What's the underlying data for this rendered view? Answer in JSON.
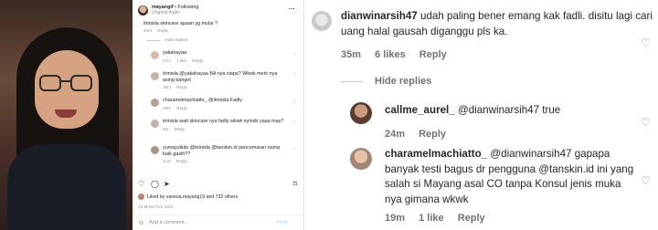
{
  "post": {
    "username": "mayangif",
    "following": "Following",
    "audio": "Original Audio",
    "more_icon": "more-horizontal-icon",
    "comments": [
      {
        "text": "itrinisla skincare apaan yg mulai ?",
        "meta": [
          "40m",
          "Reply"
        ]
      },
      {
        "text": "yakahayaa",
        "meta": [
          "27m",
          "1 like",
          "Reply"
        ]
      },
      {
        "text": "itrinisla @yakahayaa BA nya siapa? Wkwk merk nya asing banget",
        "meta": [
          "16m",
          "Reply"
        ]
      },
      {
        "text": "charamelmachiatto_ @itrinisla Fadly",
        "meta": [
          "19m",
          "Reply"
        ]
      },
      {
        "text": "itrinisla wait skincare nya fadly wkwk nyindir yaaa may?",
        "meta": [
          "9m",
          "Reply"
        ]
      },
      {
        "text": "yumaysikito @itrinisla @tanskin.id pencemaran nama baik gasih??",
        "meta": [
          "11m",
          "Reply"
        ]
      }
    ],
    "hide_replies": "Hide replies",
    "liked_by": "Liked by vanesa.mayang19 and 732 others",
    "date": "43 MINUTES AGO",
    "add_comment": "Add a comment...",
    "post_button": "Post"
  },
  "zoom": {
    "c1": {
      "username": "dianwinarsih47",
      "text": "udah paling bener emang kak fadli. disitu lagi cari uang halal gausah diganggu pls ka.",
      "time": "35m",
      "likes": "6 likes",
      "reply": "Reply"
    },
    "hide_replies": "Hide replies",
    "c2": {
      "username": "callme_aurel_",
      "text": "@dianwinarsih47 true",
      "time": "24m",
      "reply": "Reply"
    },
    "c3": {
      "username": "charamelmachiatto_",
      "text": "@dianwinarsih47 gapapa banyak testi bagus dr pengguna @tanskin.id ini yang salah si Mayang asal CO tanpa Konsul jenis muka nya gimana wkwk",
      "time": "19m",
      "likes": "1 like",
      "reply": "Reply"
    }
  }
}
